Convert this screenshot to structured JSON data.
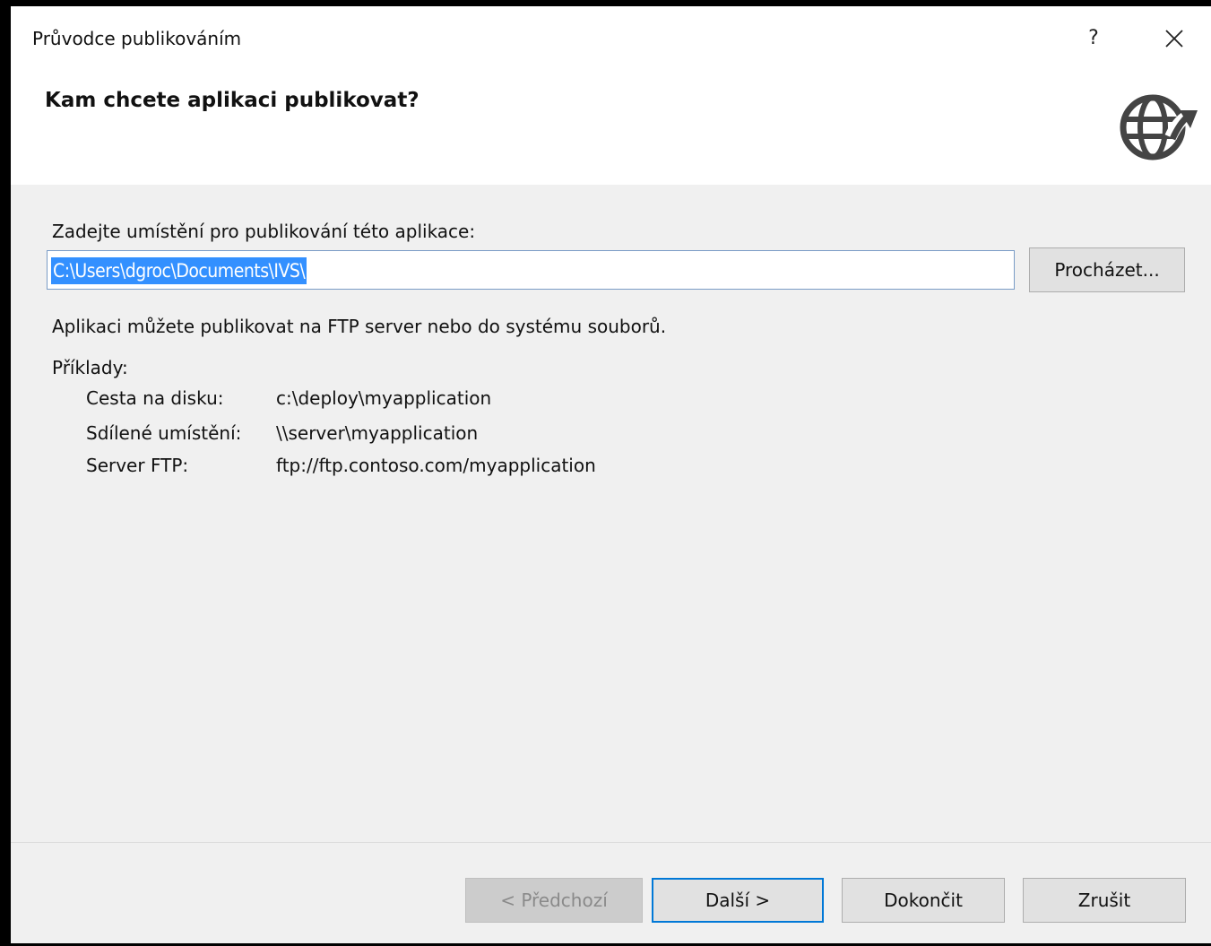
{
  "window": {
    "title": "Průvodce publikováním",
    "help_label": "?"
  },
  "header": {
    "heading": "Kam chcete aplikaci publikovat?"
  },
  "form": {
    "location_label": "Zadejte umístění pro publikování této aplikace:",
    "location_value": "C:\\Users\\dgroc\\Documents\\IVS\\",
    "browse_label": "Procházet...",
    "description": "Aplikaci můžete publikovat na FTP server nebo do systému souborů.",
    "examples_label": "Příklady:",
    "examples": [
      {
        "key": "Cesta na disku:",
        "value": "c:\\deploy\\myapplication"
      },
      {
        "key": "Sdílené umístění:",
        "value": "\\\\server\\myapplication"
      },
      {
        "key": "Server FTP:",
        "value": "ftp://ftp.contoso.com/myapplication"
      }
    ]
  },
  "footer": {
    "prev_label": "< Předchozí",
    "next_label": "Další >",
    "finish_label": "Dokončit",
    "cancel_label": "Zrušit"
  },
  "colors": {
    "selection": "#3390ff",
    "accent_border": "#0078d7",
    "dialog_bg": "#f0f0f0"
  },
  "icons": {
    "close": "close-icon",
    "header": "globe-publish-icon"
  }
}
